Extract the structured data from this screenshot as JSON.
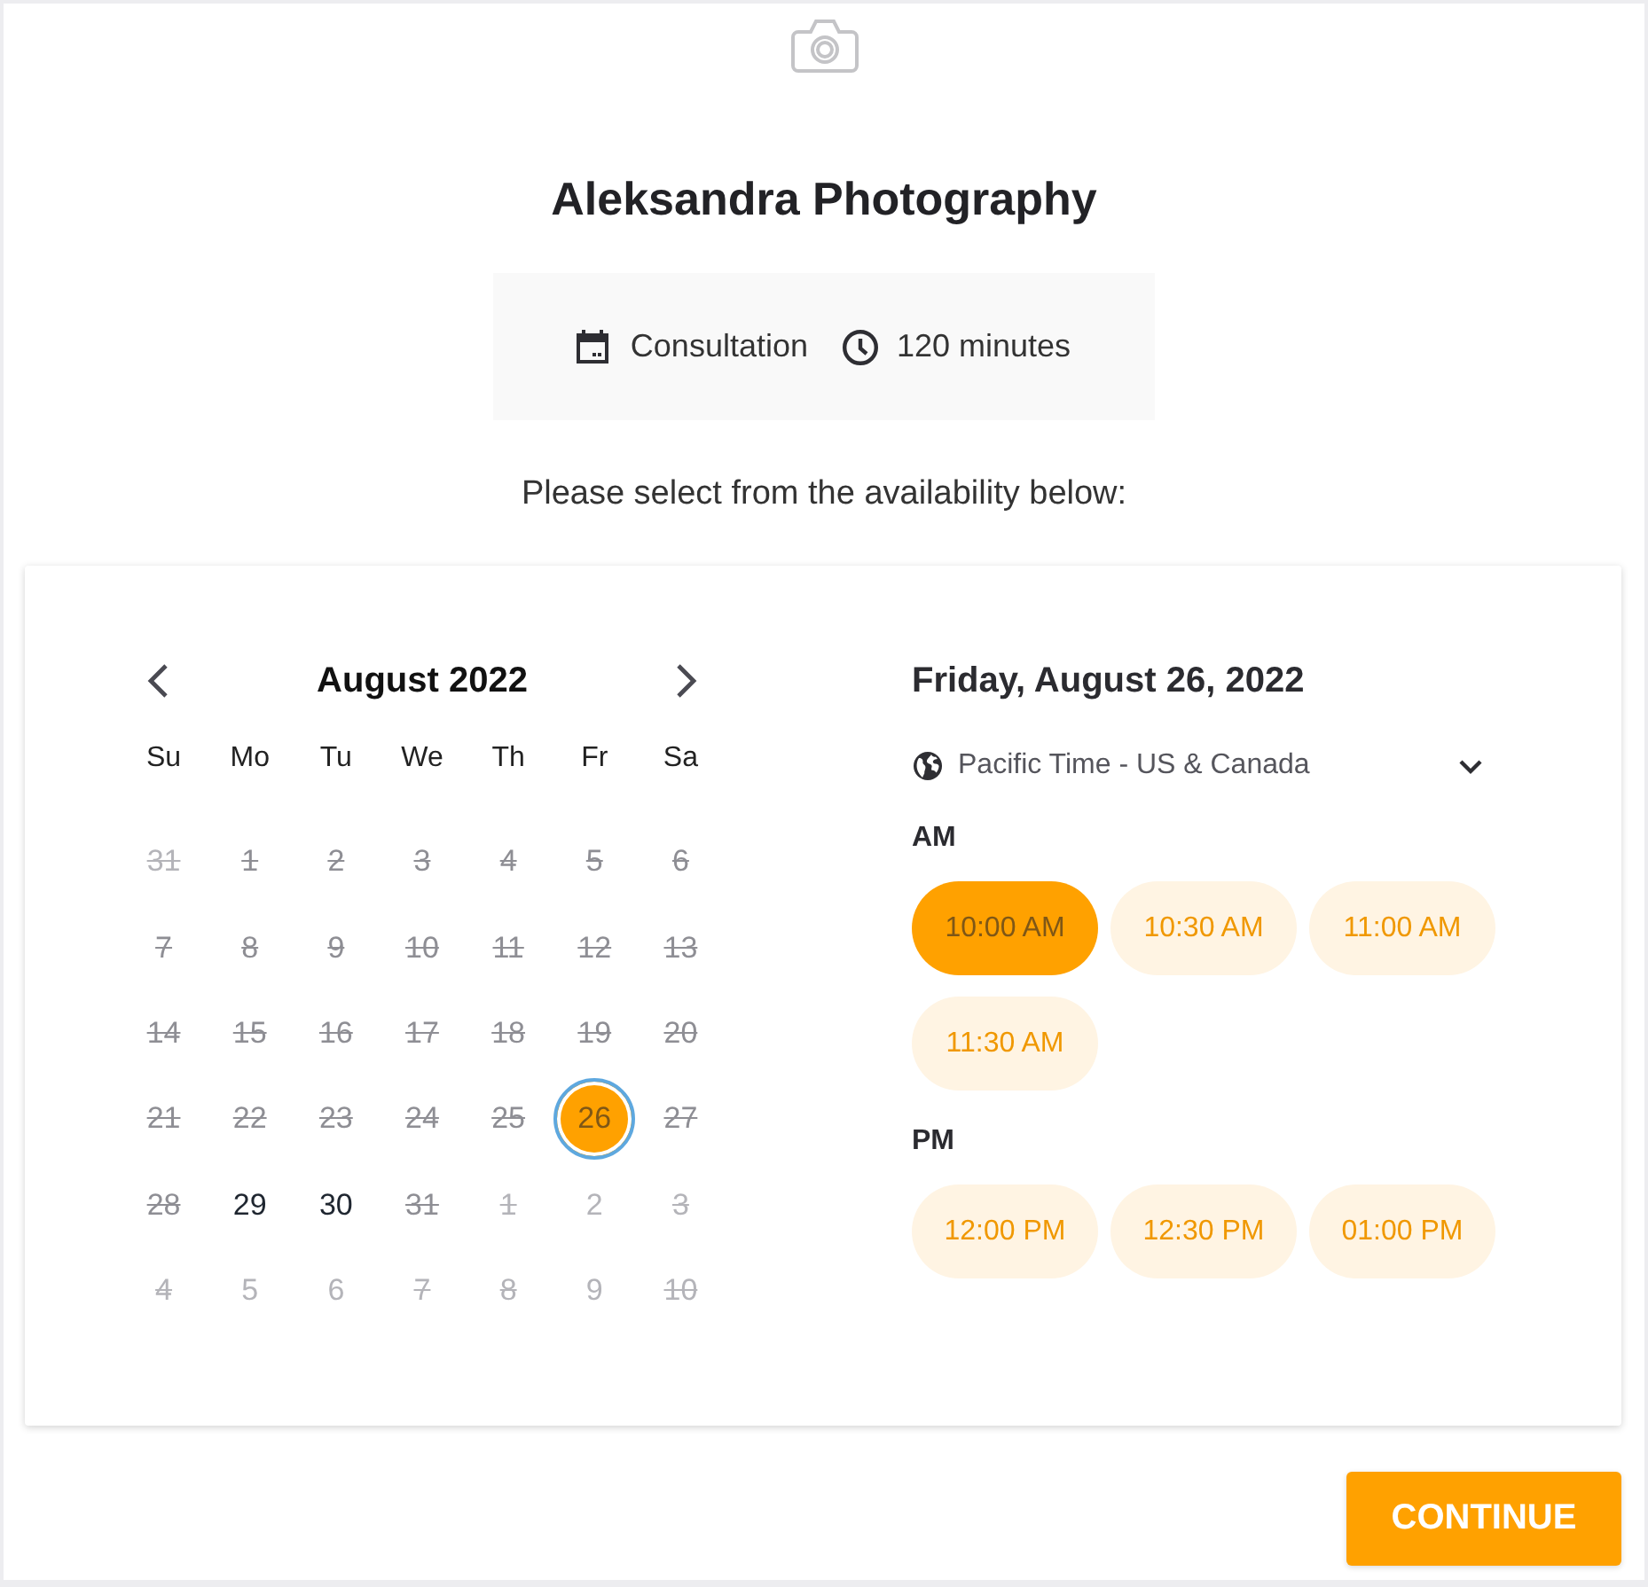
{
  "header": {
    "title": "Aleksandra Photography"
  },
  "service": {
    "name": "Consultation",
    "duration": "120 minutes"
  },
  "prompt": "Please select from the availability below:",
  "calendar": {
    "month": "August 2022",
    "weekdays": [
      "Su",
      "Mo",
      "Tu",
      "We",
      "Th",
      "Fr",
      "Sa"
    ],
    "days": [
      {
        "label": "31",
        "in_month": false,
        "available": false,
        "selected": false
      },
      {
        "label": "1",
        "in_month": true,
        "available": false,
        "selected": false
      },
      {
        "label": "2",
        "in_month": true,
        "available": false,
        "selected": false
      },
      {
        "label": "3",
        "in_month": true,
        "available": false,
        "selected": false
      },
      {
        "label": "4",
        "in_month": true,
        "available": false,
        "selected": false
      },
      {
        "label": "5",
        "in_month": true,
        "available": false,
        "selected": false
      },
      {
        "label": "6",
        "in_month": true,
        "available": false,
        "selected": false
      },
      {
        "label": "7",
        "in_month": true,
        "available": false,
        "selected": false
      },
      {
        "label": "8",
        "in_month": true,
        "available": false,
        "selected": false
      },
      {
        "label": "9",
        "in_month": true,
        "available": false,
        "selected": false
      },
      {
        "label": "10",
        "in_month": true,
        "available": false,
        "selected": false
      },
      {
        "label": "11",
        "in_month": true,
        "available": false,
        "selected": false
      },
      {
        "label": "12",
        "in_month": true,
        "available": false,
        "selected": false
      },
      {
        "label": "13",
        "in_month": true,
        "available": false,
        "selected": false
      },
      {
        "label": "14",
        "in_month": true,
        "available": false,
        "selected": false
      },
      {
        "label": "15",
        "in_month": true,
        "available": false,
        "selected": false
      },
      {
        "label": "16",
        "in_month": true,
        "available": false,
        "selected": false
      },
      {
        "label": "17",
        "in_month": true,
        "available": false,
        "selected": false
      },
      {
        "label": "18",
        "in_month": true,
        "available": false,
        "selected": false
      },
      {
        "label": "19",
        "in_month": true,
        "available": false,
        "selected": false
      },
      {
        "label": "20",
        "in_month": true,
        "available": false,
        "selected": false
      },
      {
        "label": "21",
        "in_month": true,
        "available": false,
        "selected": false
      },
      {
        "label": "22",
        "in_month": true,
        "available": false,
        "selected": false
      },
      {
        "label": "23",
        "in_month": true,
        "available": false,
        "selected": false
      },
      {
        "label": "24",
        "in_month": true,
        "available": false,
        "selected": false
      },
      {
        "label": "25",
        "in_month": true,
        "available": false,
        "selected": false
      },
      {
        "label": "26",
        "in_month": true,
        "available": true,
        "selected": true
      },
      {
        "label": "27",
        "in_month": true,
        "available": false,
        "selected": false
      },
      {
        "label": "28",
        "in_month": true,
        "available": false,
        "selected": false
      },
      {
        "label": "29",
        "in_month": true,
        "available": true,
        "selected": false
      },
      {
        "label": "30",
        "in_month": true,
        "available": true,
        "selected": false
      },
      {
        "label": "31",
        "in_month": true,
        "available": false,
        "selected": false
      },
      {
        "label": "1",
        "in_month": false,
        "available": false,
        "selected": false
      },
      {
        "label": "2",
        "in_month": false,
        "available": true,
        "selected": false
      },
      {
        "label": "3",
        "in_month": false,
        "available": false,
        "selected": false
      },
      {
        "label": "4",
        "in_month": false,
        "available": false,
        "selected": false
      },
      {
        "label": "5",
        "in_month": false,
        "available": true,
        "selected": false
      },
      {
        "label": "6",
        "in_month": false,
        "available": true,
        "selected": false
      },
      {
        "label": "7",
        "in_month": false,
        "available": false,
        "selected": false
      },
      {
        "label": "8",
        "in_month": false,
        "available": false,
        "selected": false
      },
      {
        "label": "9",
        "in_month": false,
        "available": true,
        "selected": false
      },
      {
        "label": "10",
        "in_month": false,
        "available": false,
        "selected": false
      }
    ]
  },
  "schedule": {
    "date": "Friday, August 26, 2022",
    "timezone": "Pacific Time - US & Canada",
    "groups": [
      {
        "label": "AM",
        "slots": [
          {
            "time": "10:00 AM",
            "selected": true
          },
          {
            "time": "10:30 AM",
            "selected": false
          },
          {
            "time": "11:00 AM",
            "selected": false
          },
          {
            "time": "11:30 AM",
            "selected": false
          }
        ]
      },
      {
        "label": "PM",
        "slots": [
          {
            "time": "12:00 PM",
            "selected": false
          },
          {
            "time": "12:30 PM",
            "selected": false
          },
          {
            "time": "01:00 PM",
            "selected": false
          }
        ]
      }
    ]
  },
  "continue_button": "CONTINUE"
}
